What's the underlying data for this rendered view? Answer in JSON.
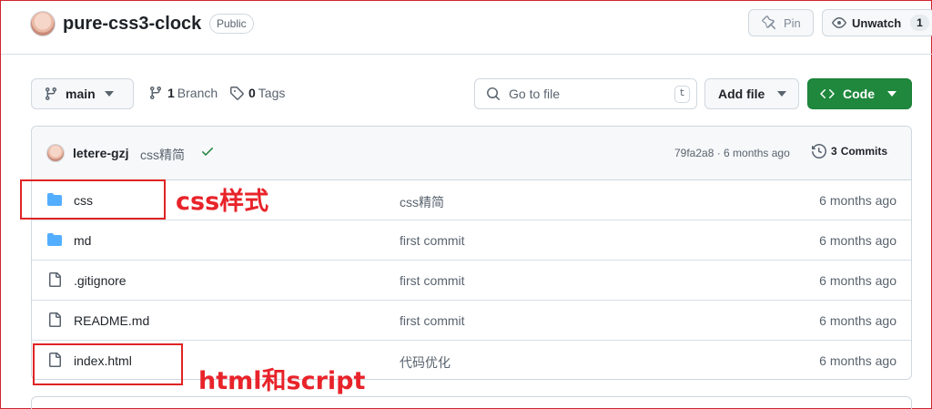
{
  "repo": {
    "name": "pure-css3-clock",
    "visibility": "Public",
    "pin_label": "Pin",
    "watch_label": "Unwatch",
    "watch_count": "1"
  },
  "toolbar": {
    "branch": "main",
    "branches_count": "1",
    "branches_label": "Branch",
    "tags_count": "0",
    "tags_label": "Tags",
    "search_placeholder": "Go to file",
    "search_shortcut": "t",
    "add_file_label": "Add file",
    "code_label": "Code"
  },
  "latest_commit": {
    "author": "letere-gzj",
    "message": "css精简",
    "hash_time": "79fa2a8 · 6 months ago",
    "commits_count": "3",
    "commits_label": "Commits"
  },
  "files": [
    {
      "icon": "folder-icon",
      "name": "css",
      "message": "css精简",
      "date": "6 months ago"
    },
    {
      "icon": "folder-icon",
      "name": "md",
      "message": "first commit",
      "date": "6 months ago"
    },
    {
      "icon": "file-icon",
      "name": ".gitignore",
      "message": "first commit",
      "date": "6 months ago"
    },
    {
      "icon": "file-icon",
      "name": "README.md",
      "message": "first commit",
      "date": "6 months ago"
    },
    {
      "icon": "file-icon",
      "name": "index.html",
      "message": "代码优化",
      "date": "6 months ago"
    }
  ],
  "annotations": {
    "css_note": "css样式",
    "html_note": "html和script"
  },
  "colors": {
    "accent_green": "#1f883d",
    "folder_blue": "#54aeff",
    "annotation_red": "#e8232a"
  }
}
